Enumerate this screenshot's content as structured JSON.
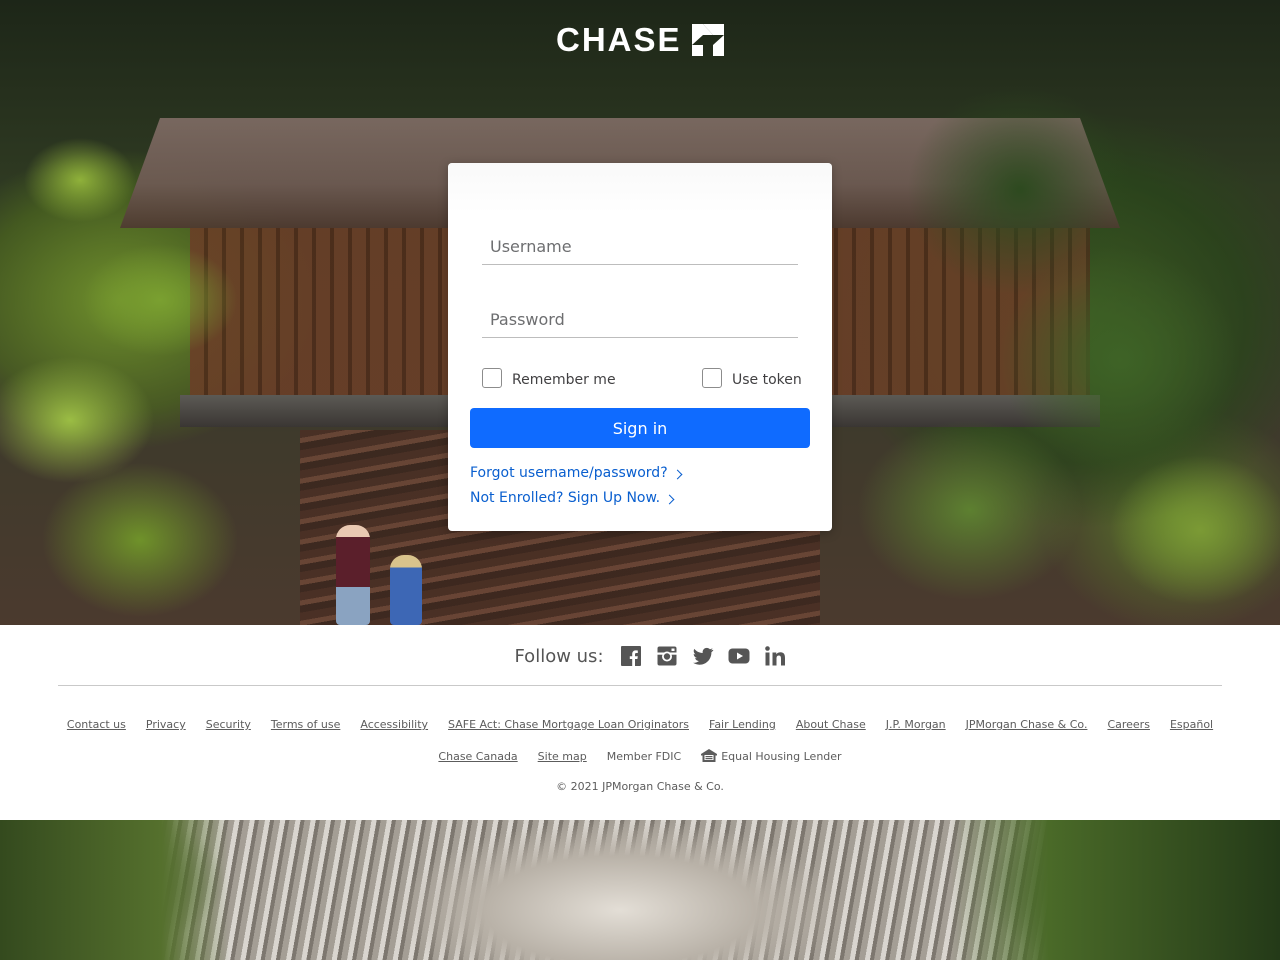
{
  "brand": {
    "name": "CHASE",
    "logo_icon": "chase-octagon-icon"
  },
  "login": {
    "username_placeholder": "Username",
    "password_placeholder": "Password",
    "remember_label": "Remember me",
    "token_label": "Use token",
    "signin_label": "Sign in",
    "forgot_link": "Forgot username/password?",
    "enroll_link": "Not Enrolled? Sign Up Now.",
    "accent_color": "#0f6bff"
  },
  "footer": {
    "follow_label": "Follow us:",
    "social_icons": [
      "facebook-icon",
      "instagram-icon",
      "twitter-icon",
      "youtube-icon",
      "linkedin-icon"
    ],
    "links_row1": [
      "Contact us",
      "Privacy",
      "Security",
      "Terms of use",
      "Accessibility",
      "SAFE Act: Chase Mortgage Loan Originators",
      "Fair Lending",
      "About Chase",
      "J.P. Morgan",
      "JPMorgan Chase & Co.",
      "Careers",
      "Español"
    ],
    "links_row2": [
      "Chase Canada",
      "Site map"
    ],
    "member_fdic": "Member FDIC",
    "equal_housing": "Equal Housing Lender",
    "copyright": "© 2021 JPMorgan Chase & Co."
  }
}
